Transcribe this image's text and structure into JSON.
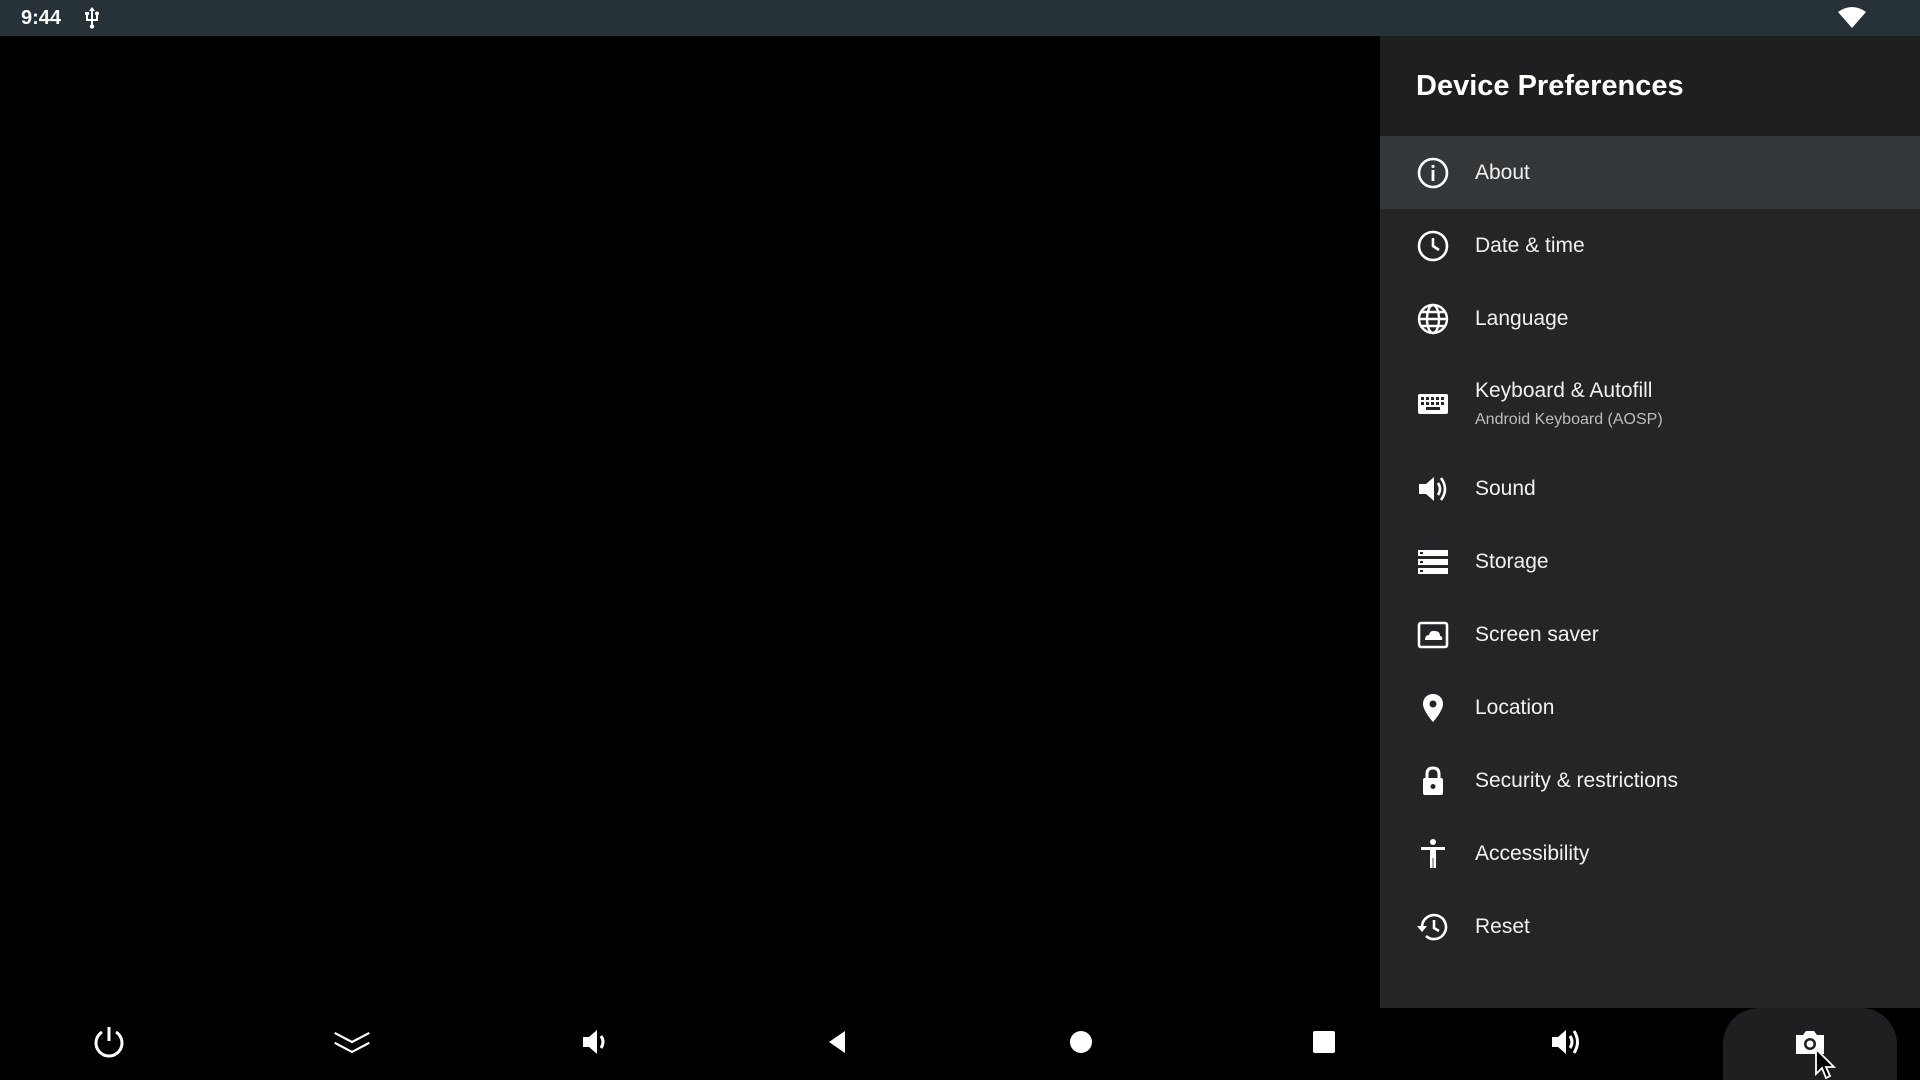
{
  "status_bar": {
    "time": "9:44",
    "icons": [
      "usb-icon",
      "wifi-icon"
    ]
  },
  "panel": {
    "title": "Device Preferences",
    "items": [
      {
        "label": "About",
        "icon": "info-icon",
        "focused": true
      },
      {
        "label": "Date & time",
        "icon": "clock-icon"
      },
      {
        "label": "Language",
        "icon": "globe-icon"
      },
      {
        "label": "Keyboard & Autofill",
        "sublabel": "Android Keyboard (AOSP)",
        "icon": "keyboard-icon"
      },
      {
        "label": "Sound",
        "icon": "speaker-icon"
      },
      {
        "label": "Storage",
        "icon": "storage-icon"
      },
      {
        "label": "Screen saver",
        "icon": "screen-saver-icon"
      },
      {
        "label": "Location",
        "icon": "location-pin-icon"
      },
      {
        "label": "Security & restrictions",
        "icon": "lock-icon"
      },
      {
        "label": "Accessibility",
        "icon": "accessibility-icon"
      },
      {
        "label": "Reset",
        "icon": "history-icon"
      }
    ]
  },
  "nav_bar": {
    "buttons": [
      "power-icon",
      "collapse-icon",
      "volume-down-icon",
      "back-icon",
      "home-icon",
      "recents-icon",
      "volume-up-icon",
      "screenshot-icon"
    ]
  },
  "colors": {
    "status_bar_bg": "#263238",
    "panel_bg": "#232527",
    "panel_header_bg": "#1d1f21",
    "focused_item_bg": "#34373a"
  }
}
